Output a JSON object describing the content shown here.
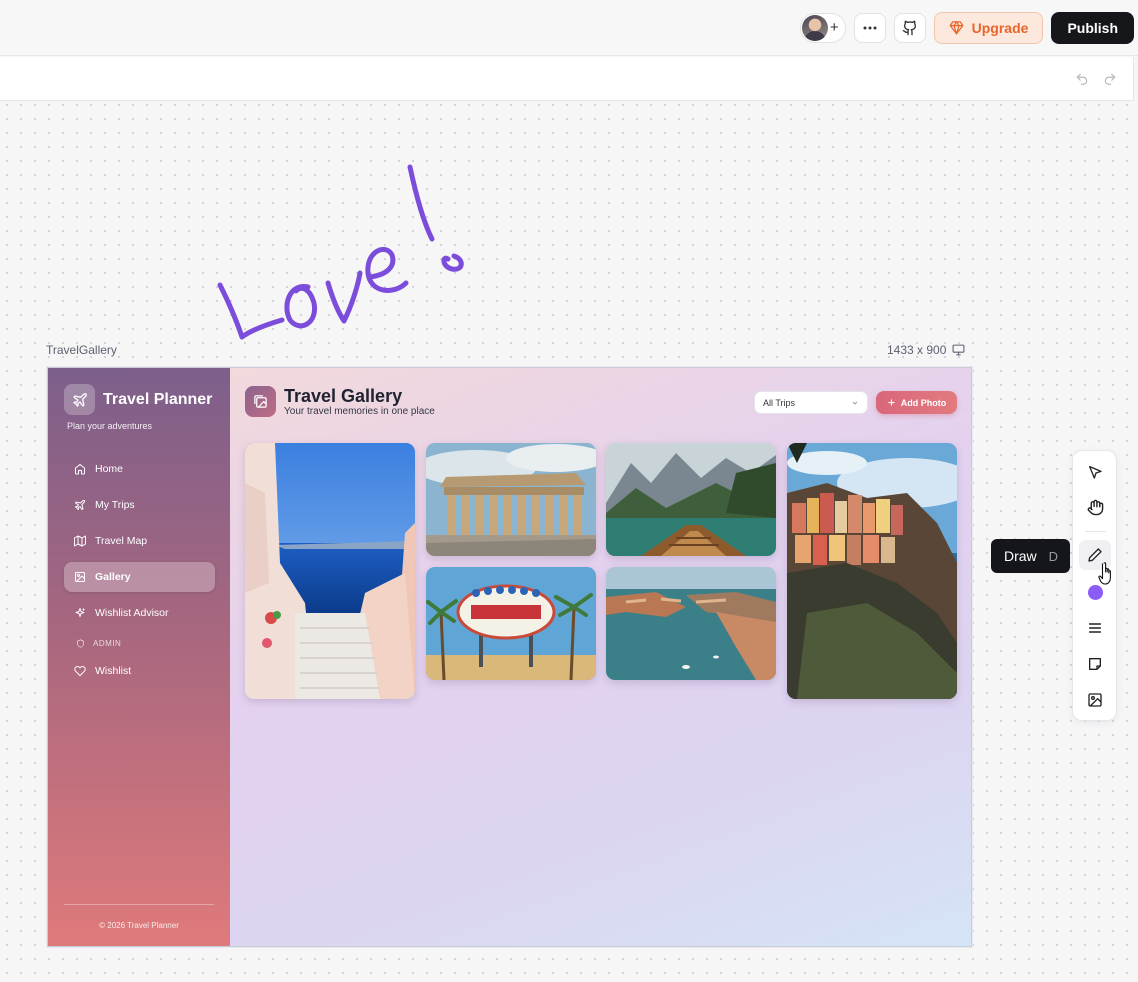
{
  "toolbar": {
    "upgrade_label": "Upgrade",
    "publish_label": "Publish",
    "avatar_plus": "+"
  },
  "canvas": {
    "handwriting": "Love !",
    "handwriting_color": "#7c4ddb",
    "frame_label": "TravelGallery",
    "frame_size": "1433 x 900"
  },
  "app": {
    "brand_name": "Travel Planner",
    "brand_tagline": "Plan your adventures",
    "nav": [
      {
        "label": "Home",
        "icon": "home-icon"
      },
      {
        "label": "My Trips",
        "icon": "plane-icon"
      },
      {
        "label": "Travel Map",
        "icon": "map-icon"
      },
      {
        "label": "Gallery",
        "icon": "gallery-icon",
        "active": true
      },
      {
        "label": "Wishlist Advisor",
        "icon": "sparkle-icon"
      }
    ],
    "admin_section": "ADMIN",
    "admin_nav": [
      {
        "label": "Wishlist",
        "icon": "heart-icon"
      }
    ],
    "footer": "© 2026 Travel Planner",
    "page_title": "Travel Gallery",
    "page_subtitle": "Your travel memories in one place",
    "trip_filter": "All Trips",
    "add_photo_label": "Add Photo",
    "photos": [
      "Santorini stairs",
      "Parthenon",
      "Mountain lake boat",
      "Cinque Terre",
      "Las Vegas sign",
      "Dubrovnik"
    ]
  },
  "tools": {
    "tooltip_label": "Draw",
    "tooltip_key": "D",
    "items": [
      "select-icon",
      "hand-icon",
      "pencil-icon",
      "color-swatch",
      "menu-icon",
      "note-icon",
      "image-icon"
    ],
    "active_color": "#8b5cf6"
  }
}
